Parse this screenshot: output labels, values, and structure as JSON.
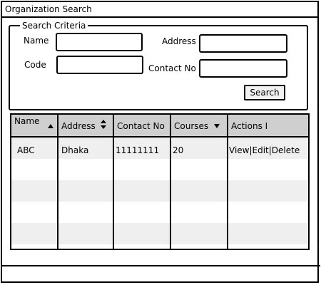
{
  "window": {
    "title": "Organization Search"
  },
  "criteria": {
    "legend": "Search Criteria",
    "name_label": "Name",
    "code_label": "Code",
    "address_label": "Address",
    "contact_label": "Contact No",
    "name_value": "",
    "code_value": "",
    "address_value": "",
    "contact_value": "",
    "search_button": "Search"
  },
  "table": {
    "columns": [
      {
        "label": "Name",
        "sort_icon": "sort-up-icon"
      },
      {
        "label": "Address",
        "sort_icon": "sort-both-icon"
      },
      {
        "label": "Contact No",
        "sort_icon": ""
      },
      {
        "label": "Courses",
        "sort_icon": "sort-down-icon"
      },
      {
        "label": "Actions I",
        "sort_icon": ""
      }
    ],
    "rows": [
      {
        "name": "ABC",
        "address": "Dhaka",
        "contact": "11111111",
        "courses": "20",
        "actions": "View|Edit|Delete"
      }
    ],
    "stripe_color": "#efefef",
    "header_color": "#cfcfcf"
  }
}
